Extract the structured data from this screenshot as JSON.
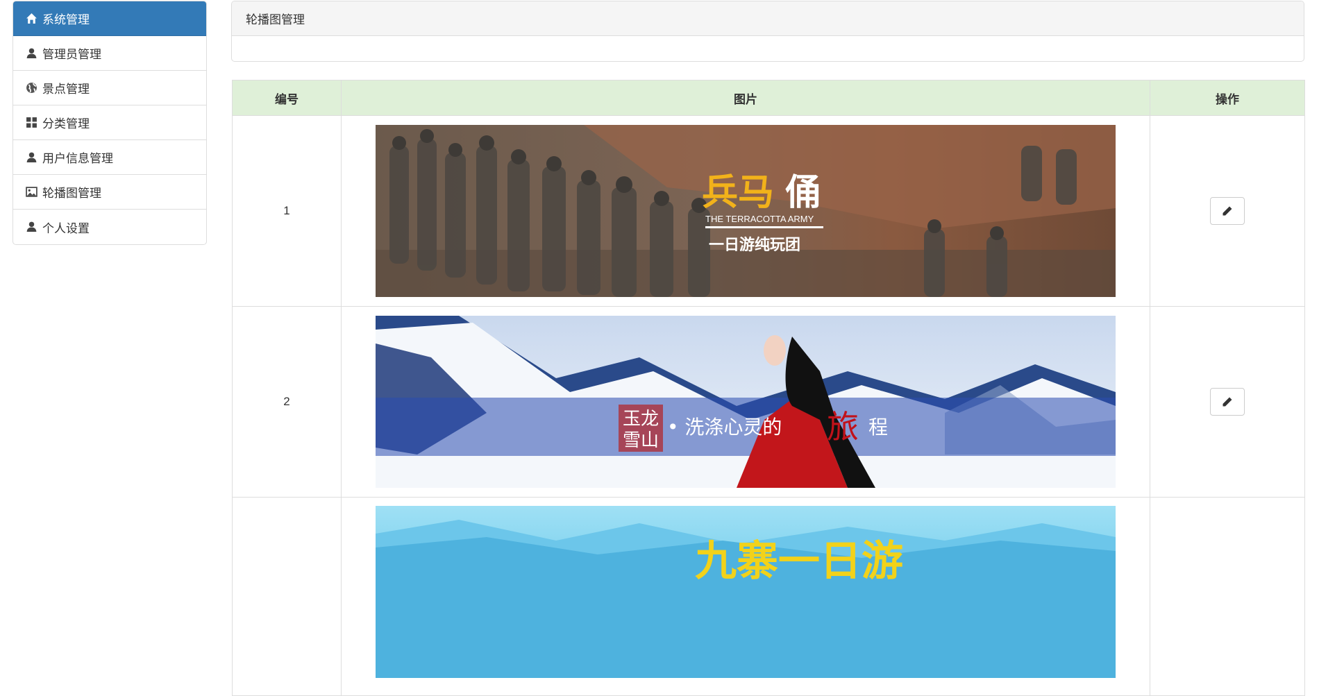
{
  "sidebar": {
    "items": [
      {
        "label": "系统管理",
        "icon": "home-icon"
      },
      {
        "label": "管理员管理",
        "icon": "user-icon"
      },
      {
        "label": "景点管理",
        "icon": "globe-icon"
      },
      {
        "label": "分类管理",
        "icon": "grid-icon"
      },
      {
        "label": "用户信息管理",
        "icon": "user-icon"
      },
      {
        "label": "轮播图管理",
        "icon": "picture-icon"
      },
      {
        "label": "个人设置",
        "icon": "user-icon"
      }
    ]
  },
  "panel": {
    "title": "轮播图管理"
  },
  "table": {
    "headers": [
      "编号",
      "图片",
      "操作"
    ],
    "rows": [
      {
        "id": "1",
        "banner": {
          "title_part1": "兵马",
          "title_part2": "俑",
          "subtitle": "THE TERRACOTTA ARMY",
          "tagline": "一日游纯玩团"
        }
      },
      {
        "id": "2",
        "banner": {
          "seal_line1": "玉龙",
          "seal_line2": "雪山",
          "tagline_main": "• 洗涤心灵的",
          "tagline_big": "旅",
          "tagline_end": "程"
        }
      },
      {
        "id": "",
        "banner": {
          "title": "九寨一日游"
        }
      }
    ]
  },
  "colors": {
    "primary": "#337ab7",
    "header_bg": "#dff0d8",
    "panel_head_bg": "#f5f5f5",
    "border": "#dddddd"
  }
}
